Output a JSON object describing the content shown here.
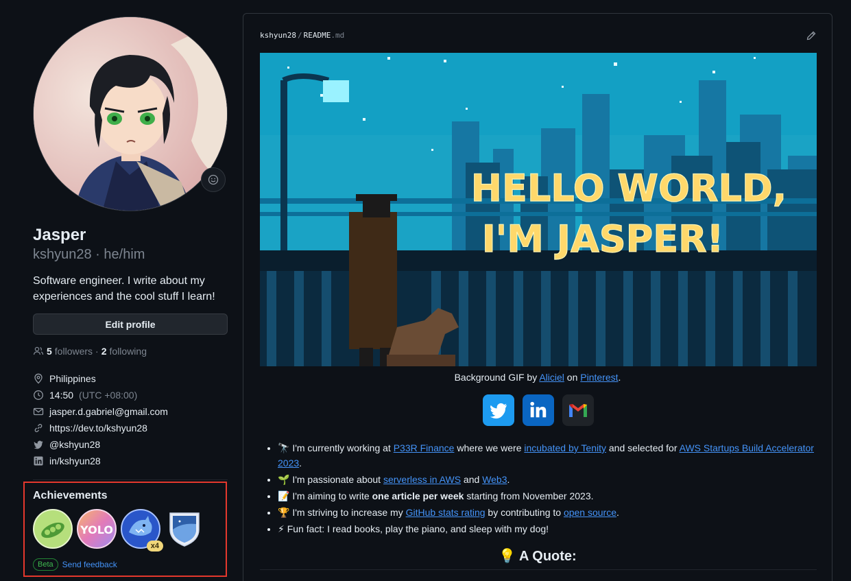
{
  "profile": {
    "name": "Jasper",
    "login_line": "kshyun28 · he/him",
    "bio": "Software engineer. I write about my experiences and the cool stuff I learn!",
    "edit_button": "Edit profile",
    "followers_count": "5",
    "followers_label": "followers",
    "dot": "·",
    "following_count": "2",
    "following_label": "following"
  },
  "details": {
    "location": "Philippines",
    "time": "14:50",
    "timezone": "(UTC +08:00)",
    "email": "jasper.d.gabriel@gmail.com",
    "website": "https://dev.to/kshyun28",
    "twitter": "@kshyun28",
    "linkedin": "in/kshyun28"
  },
  "achievements": {
    "title": "Achievements",
    "multiplier": "x4",
    "beta": "Beta",
    "feedback": "Send feedback"
  },
  "readme": {
    "owner": "kshyun28",
    "separator": "/",
    "file": "README",
    "ext": ".md",
    "banner_line1": "HELLO WORLD,",
    "banner_line2": "I'M JASPER!",
    "caption_pre": "Background GIF by ",
    "caption_link1": "Aliciel",
    "caption_mid": " on ",
    "caption_link2": "Pinterest",
    "caption_post": ".",
    "b1_pre": "🔭 I'm currently working at ",
    "b1_link1": "P33R Finance",
    "b1_mid1": " where we were ",
    "b1_link2": "incubated by Tenity",
    "b1_mid2": " and selected for ",
    "b1_link3": "AWS Startups Build Accelerator 2023",
    "b1_post": ".",
    "b2_pre": "🌱 I'm passionate about ",
    "b2_link1": "serverless in AWS",
    "b2_mid": " and ",
    "b2_link2": "Web3",
    "b2_post": ".",
    "b3_pre": "📝 I'm aiming to write ",
    "b3_bold": "one article per week",
    "b3_post": " starting from November 2023.",
    "b4_pre": "🏆 I'm striving to increase my ",
    "b4_link1": "GitHub stats rating",
    "b4_mid": " by contributing to ",
    "b4_link2": "open source",
    "b4_post": ".",
    "b5": "⚡ Fun fact: I read books, play the piano, and sleep with my dog!",
    "quote_heading": "💡 A Quote:"
  },
  "colors": {
    "accent_link": "#4493f8",
    "highlight_border": "#e5382d",
    "banner_text": "#ffd86b"
  }
}
